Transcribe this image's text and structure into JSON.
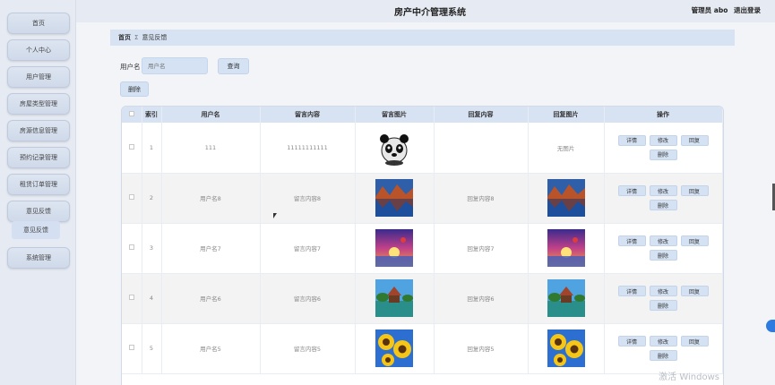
{
  "app": {
    "title": "房产中介管理系统",
    "user_text": "管理员 abo",
    "logout_label": "退出登录"
  },
  "sidebar": {
    "items": [
      {
        "label": "首页"
      },
      {
        "label": "个人中心"
      },
      {
        "label": "用户管理"
      },
      {
        "label": "房屋类型管理"
      },
      {
        "label": "房源信息管理"
      },
      {
        "label": "预约记录管理"
      },
      {
        "label": "租赁订单管理"
      },
      {
        "label": "意见反馈"
      },
      {
        "label": "系统管理"
      }
    ],
    "active_sub": "意见反馈"
  },
  "breadcrumb": {
    "home": "首页",
    "sep": "Σ",
    "current": "意见反馈"
  },
  "search": {
    "label": "用户名",
    "placeholder": "用户名",
    "button": "查询"
  },
  "toolbar": {
    "delete_label": "删除"
  },
  "table": {
    "headers": [
      "索引",
      "用户名",
      "留言内容",
      "留言图片",
      "回复内容",
      "回复图片",
      "操作"
    ],
    "rows": [
      {
        "index": "1",
        "username": "111",
        "message": "11111111111",
        "reply": "",
        "no_reply_image": "无图片",
        "msg_img": "panda",
        "reply_img": "none"
      },
      {
        "index": "2",
        "username": "用户名8",
        "message": "留言内容8",
        "reply": "回复内容8",
        "no_reply_image": "",
        "msg_img": "lake",
        "reply_img": "lake"
      },
      {
        "index": "3",
        "username": "用户名7",
        "message": "留言内容7",
        "reply": "回复内容7",
        "no_reply_image": "",
        "msg_img": "sunset",
        "reply_img": "sunset"
      },
      {
        "index": "4",
        "username": "用户名6",
        "message": "留言内容6",
        "reply": "回复内容6",
        "no_reply_image": "",
        "msg_img": "pavilion",
        "reply_img": "pavilion"
      },
      {
        "index": "5",
        "username": "用户名5",
        "message": "留言内容5",
        "reply": "回复内容5",
        "no_reply_image": "",
        "msg_img": "sunflower",
        "reply_img": "sunflower"
      }
    ],
    "row_actions": {
      "detail": "详情",
      "edit": "修改",
      "reply": "回复",
      "delete": "删除"
    }
  },
  "watermark": "激活 Windows",
  "colors": {
    "accent": "#d4e2f4",
    "header_bg": "#d7e3f3",
    "float_button": "#2d7be0"
  }
}
